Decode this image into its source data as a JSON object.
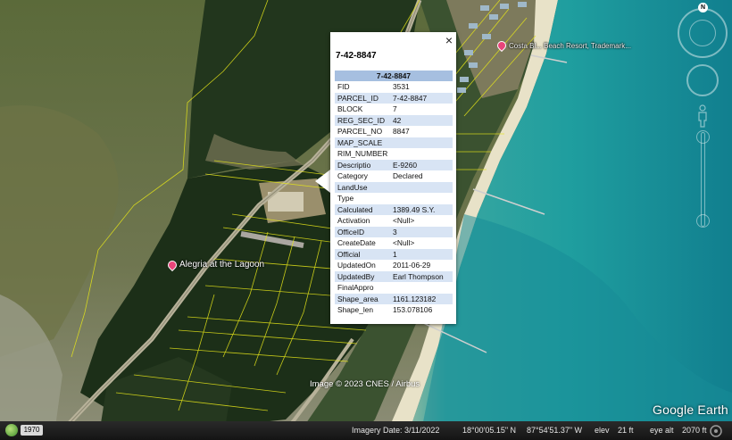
{
  "map": {
    "placemarks": [
      {
        "label": "Costa Bl... Beach Resort, Trademark..."
      },
      {
        "label": "Alegria at the Lagoon"
      }
    ],
    "copyright": "Image © 2023 CNES / Airbus",
    "brand": "Google Earth",
    "compass_north": "N"
  },
  "balloon": {
    "close_label": "×",
    "title": "7-42-8847",
    "table_header": "7-42-8847",
    "rows": [
      {
        "key": "FID",
        "value": "3531"
      },
      {
        "key": "PARCEL_ID",
        "value": "7-42-8847"
      },
      {
        "key": "BLOCK",
        "value": "7"
      },
      {
        "key": "REG_SEC_ID",
        "value": "42"
      },
      {
        "key": "PARCEL_NO",
        "value": "8847"
      },
      {
        "key": "MAP_SCALE",
        "value": ""
      },
      {
        "key": "RIM_NUMBER",
        "value": ""
      },
      {
        "key": "Descriptio",
        "value": "E-9260"
      },
      {
        "key": "Category",
        "value": "Declared"
      },
      {
        "key": "LandUse",
        "value": ""
      },
      {
        "key": "Type",
        "value": ""
      },
      {
        "key": "Calculated",
        "value": "1389.49 S.Y."
      },
      {
        "key": "Activation",
        "value": "<Null>"
      },
      {
        "key": "OfficeID",
        "value": "3"
      },
      {
        "key": "CreateDate",
        "value": "<Null>"
      },
      {
        "key": "Official",
        "value": "1"
      },
      {
        "key": "UpdatedOn",
        "value": "2011-06-29"
      },
      {
        "key": "UpdatedBy",
        "value": "Earl Thompson"
      },
      {
        "key": "FinalAppro",
        "value": ""
      },
      {
        "key": "Shape_area",
        "value": "1161.123182"
      },
      {
        "key": "Shape_len",
        "value": "153.078106"
      }
    ]
  },
  "status_bar": {
    "year": "1970",
    "imagery_date": "Imagery Date: 3/11/2022",
    "latitude": "18°00'05.15\" N",
    "longitude": "87°54'51.37\" W",
    "elev_label": "elev",
    "elev_value": "21 ft",
    "eye_alt_label": "eye alt",
    "eye_alt_value": "2070 ft"
  },
  "colors": {
    "parcel_lines": "#e6e619",
    "pin": "#e8457a",
    "table_header": "#a6bfe0",
    "table_alt_row": "#d8e4f4",
    "sea": "#1fa8a4"
  },
  "icons": [
    "close-icon",
    "placemark-pin-icon",
    "compass-icon",
    "look-joystick-icon",
    "street-view-person-icon",
    "zoom-slider-icon",
    "historical-imagery-icon",
    "streaming-icon"
  ]
}
